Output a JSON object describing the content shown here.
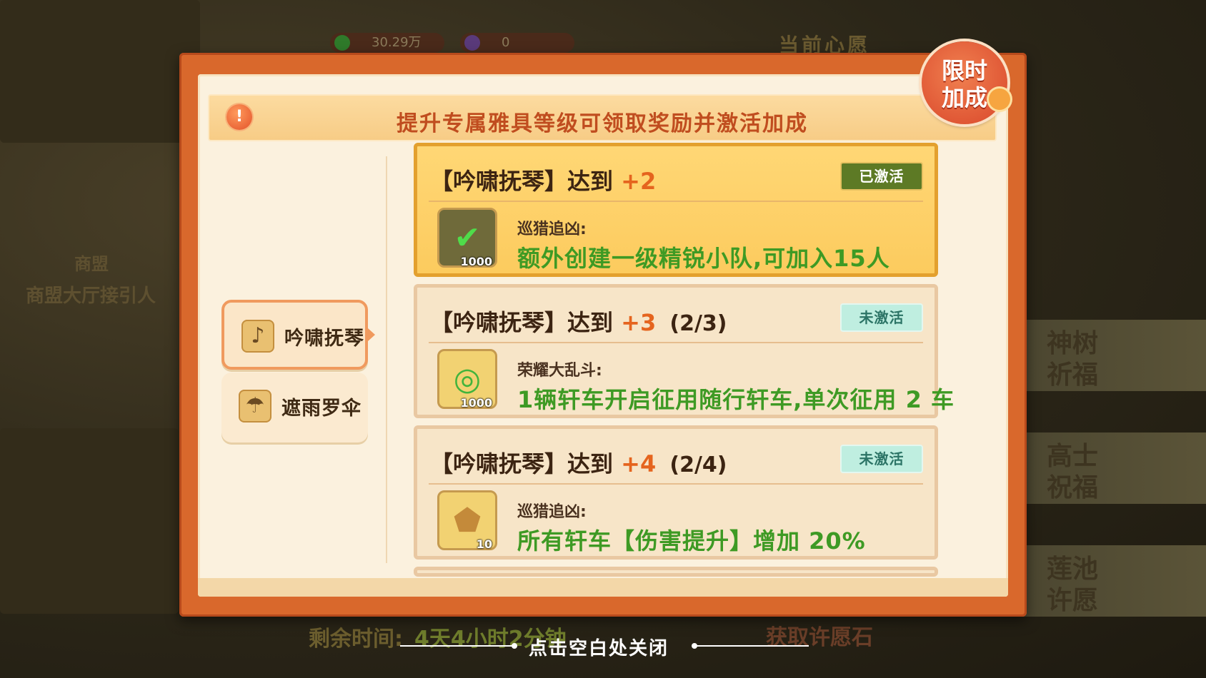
{
  "background": {
    "currency1": "30.29万",
    "currency2": "0",
    "title": "当前心愿",
    "guild_label": "商盟",
    "guild_npc": "商盟大厅接引人",
    "side_cards": [
      "神树\n祈福",
      "高士\n祝福",
      "莲池\n许愿"
    ],
    "timer_label": "剩余时间:",
    "timer_value": "4天4小时2分钟",
    "get_stone": "获取许愿石"
  },
  "modal": {
    "banner_text": "提升专属雅具等级可领取奖励并激活加成",
    "ribbon": "限时\n加成",
    "tabs": [
      {
        "label": "吟啸抚琴",
        "icon": "guitar-icon",
        "active": true
      },
      {
        "label": "遮雨罗伞",
        "icon": "umbrella-icon",
        "active": false
      }
    ],
    "cards": [
      {
        "title": "【吟啸抚琴】达到",
        "level": "+2",
        "progress": "",
        "status": "已激活",
        "active": true,
        "item_qty": "1000",
        "effect_name": "巡猎追凶:",
        "effect_desc": "额外创建一级精锐小队,可加入15人"
      },
      {
        "title": "【吟啸抚琴】达到",
        "level": "+3",
        "progress": "(2/3)",
        "status": "未激活",
        "active": false,
        "item_qty": "1000",
        "effect_name": "荣耀大乱斗:",
        "effect_desc": "1辆轩车开启征用随行轩车,单次征用 2 车"
      },
      {
        "title": "【吟啸抚琴】达到",
        "level": "+4",
        "progress": "(2/4)",
        "status": "未激活",
        "active": false,
        "item_qty": "10",
        "effect_name": "巡猎追凶:",
        "effect_desc": "所有轩车【伤害提升】增加 20%"
      }
    ],
    "close_hint": "点击空白处关闭"
  }
}
